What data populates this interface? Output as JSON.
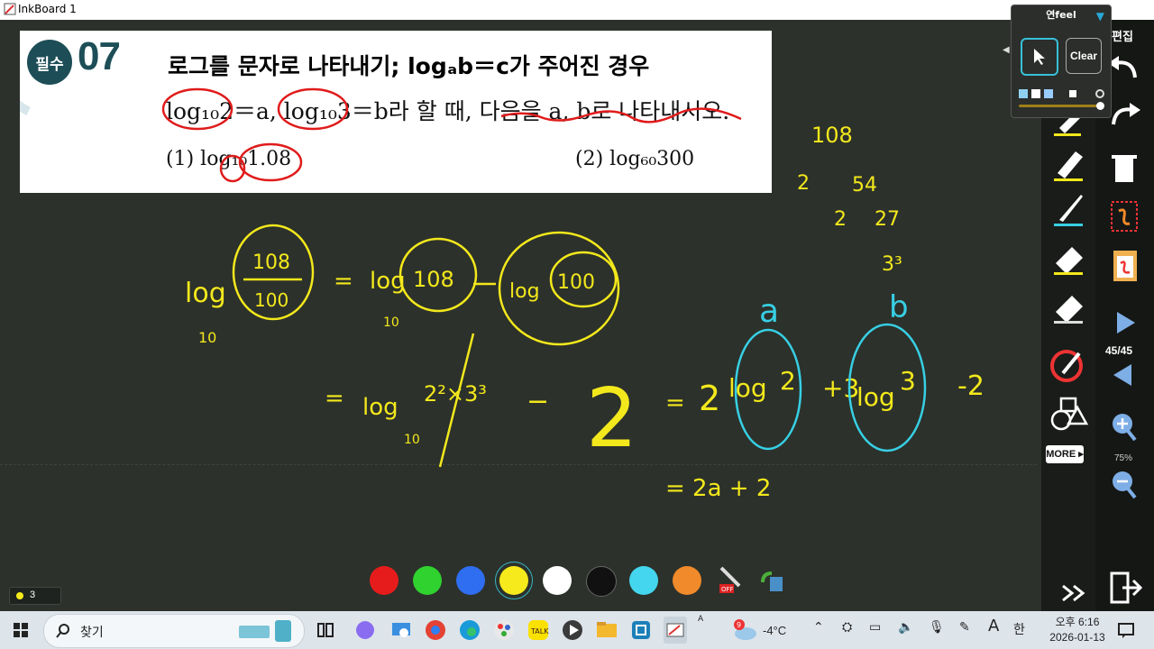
{
  "window": {
    "title": "InkBoard 1"
  },
  "problem": {
    "badge": "필수",
    "number": "07",
    "heading": "로그를 문자로 나타내기; logₐb＝c가 주어진 경우",
    "condition": "log₁₀2＝a, log₁₀3＝b라 할 때, 다음을 a, b로 나타내시오.",
    "item1": "(1) log₁₀1.08",
    "item2": "(2) log₆₀300"
  },
  "ink_notes": {
    "log_fraction_num": "108",
    "log_fraction_den": "100",
    "step1_a": "108",
    "step1_b": "100",
    "step2_a": "2²×3³",
    "step2_b": "2",
    "step3_a": "2log₁₀2",
    "step3_b": "3log₁₀3",
    "step3_c": "-2",
    "label_a": "a",
    "label_b": "b",
    "factor_top": "108",
    "factor_1": "54",
    "factor_2": "27",
    "factor_3": "3³",
    "factor_d1": "2",
    "factor_d2": "2",
    "final": "= 2a + 2"
  },
  "page_counter": {
    "label": "3"
  },
  "palette": [
    {
      "name": "red",
      "color": "#e61c1c"
    },
    {
      "name": "green",
      "color": "#2fd22f"
    },
    {
      "name": "blue",
      "color": "#2f6ef0"
    },
    {
      "name": "yellow",
      "color": "#f6ea1c",
      "selected": true
    },
    {
      "name": "white",
      "color": "#ffffff"
    },
    {
      "name": "black",
      "color": "#111111"
    },
    {
      "name": "cyan",
      "color": "#43d6ee"
    },
    {
      "name": "orange",
      "color": "#f08a2a"
    }
  ],
  "pen_popup": {
    "title": "연feel",
    "clear_label": "Clear"
  },
  "right_panel": {
    "edit_label": "편집",
    "page_indicator": "45/45",
    "zoom": "75%",
    "more_label": "MORE"
  },
  "taskbar": {
    "search_label": "찾기",
    "weather_temp": "-4°C",
    "weather_badge": "9",
    "clock_time": "오후 6:16",
    "clock_date": "2026-01-13",
    "ime_label": "A",
    "lang_label": "한"
  }
}
